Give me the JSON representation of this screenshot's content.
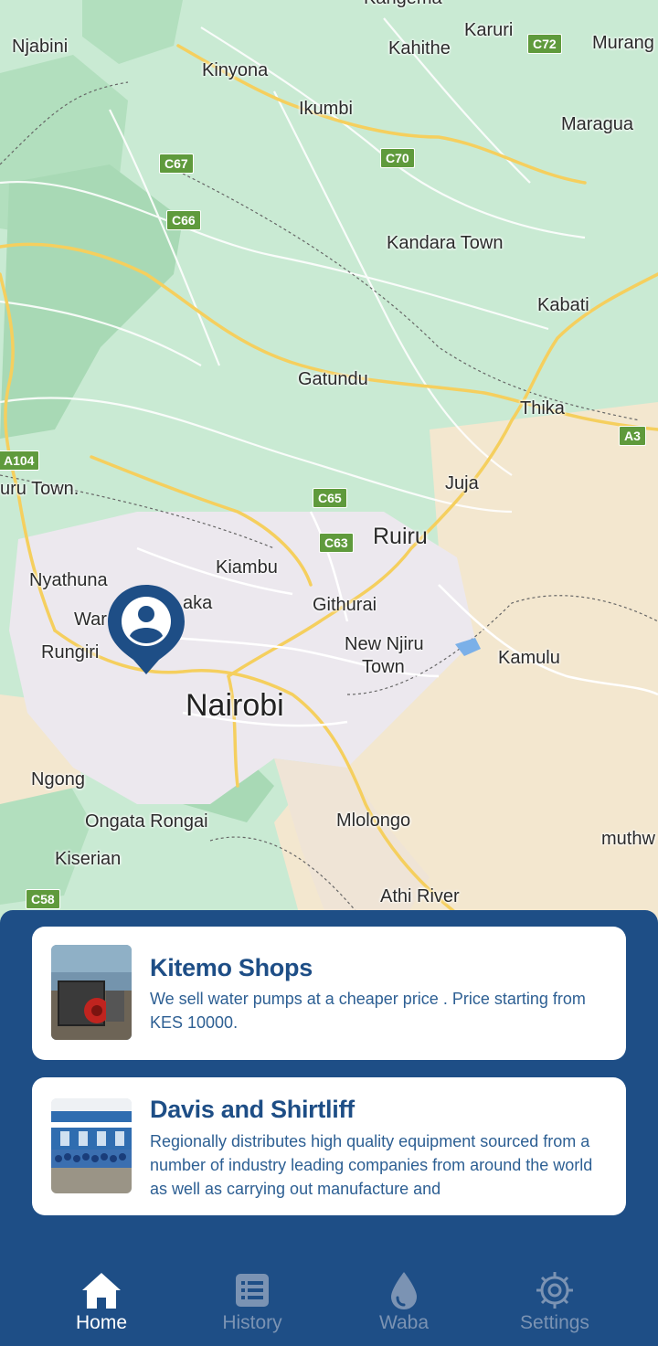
{
  "map": {
    "places": [
      {
        "label": "Njabini"
      },
      {
        "label": "Kahithe"
      },
      {
        "label": "Karuri"
      },
      {
        "label": "Murang"
      },
      {
        "label": "Kinyona"
      },
      {
        "label": "Ikumbi"
      },
      {
        "label": "Maragua"
      },
      {
        "label": "Kandara Town"
      },
      {
        "label": "Kabati"
      },
      {
        "label": "Gatundu"
      },
      {
        "label": "Thika"
      },
      {
        "label": "Juja"
      },
      {
        "label": "uru Town."
      },
      {
        "label": "Ruiru"
      },
      {
        "label": "Kiambu"
      },
      {
        "label": "Nyathuna"
      },
      {
        "label": "aka"
      },
      {
        "label": "War"
      },
      {
        "label": "Githurai"
      },
      {
        "label": "New Njiru"
      },
      {
        "label": "Town"
      },
      {
        "label": "Rungiri"
      },
      {
        "label": "Kamulu"
      },
      {
        "label": "Nairobi"
      },
      {
        "label": "Ngong"
      },
      {
        "label": "Ongata Rongai"
      },
      {
        "label": "Mlolongo"
      },
      {
        "label": "muthw"
      },
      {
        "label": "Kiserian"
      },
      {
        "label": "Athi River"
      },
      {
        "label": "Kangema"
      }
    ],
    "road_shields": [
      {
        "label": "C72"
      },
      {
        "label": "C67"
      },
      {
        "label": "C70"
      },
      {
        "label": "C66"
      },
      {
        "label": "A104"
      },
      {
        "label": "A3"
      },
      {
        "label": "C65"
      },
      {
        "label": "C63"
      },
      {
        "label": "C58"
      }
    ],
    "colors": {
      "land": "#c9ead3",
      "urban": "#ece8ee",
      "dry": "#f3e7cf",
      "road": "#f5d46a",
      "pin": "#1e4e86"
    }
  },
  "shops": [
    {
      "name": "Kitemo Shops",
      "description": "We sell water pumps at a cheaper price . Price starting from KES 10000."
    },
    {
      "name": "Davis and Shirtliff",
      "description": "Regionally distributes high quality equipment sourced from a number of industry leading companies from around the world as well as carrying out manufacture and"
    }
  ],
  "nav": {
    "items": [
      {
        "label": "Home",
        "icon": "home-icon",
        "active": true
      },
      {
        "label": "History",
        "icon": "list-icon",
        "active": false
      },
      {
        "label": "Waba",
        "icon": "water-drop-icon",
        "active": false
      },
      {
        "label": "Settings",
        "icon": "gear-icon",
        "active": false
      }
    ]
  },
  "colors": {
    "primary": "#1e4e86",
    "nav_inactive": "#7b93b3",
    "nav_active": "#ffffff"
  }
}
